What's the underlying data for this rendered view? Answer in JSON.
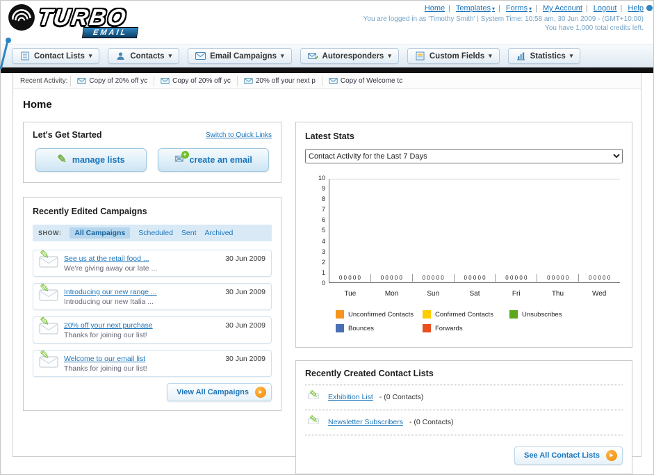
{
  "colors": {
    "link_blue": "#1B75BB",
    "accent_orange": "#F7941D",
    "bar_black": "#101010"
  },
  "header": {
    "logo_main": "TURBO",
    "logo_sub": "EMAIL",
    "nav": [
      {
        "label": "Home"
      },
      {
        "label": "Templates"
      },
      {
        "label": "Forms"
      },
      {
        "label": "My Account"
      },
      {
        "label": "Logout"
      },
      {
        "label": "Help"
      }
    ],
    "login_line": "You are logged in as 'Timothy Smith' | System Time: 10:58 am, 30 Jun 2009 - (GMT+10:00)",
    "credits_line": "You have 1,000 total credits left."
  },
  "main_nav": {
    "items": [
      "Contact Lists",
      "Contacts",
      "Email Campaigns",
      "Autoresponders",
      "Custom Fields",
      "Statistics"
    ]
  },
  "recent_activity": {
    "label": "Recent Activity:",
    "items": [
      "Copy of 20% off yc",
      "Copy of 20% off yc",
      "20% off your next p",
      "Copy of Welcome tc"
    ]
  },
  "page": {
    "title": "Home"
  },
  "getting_started": {
    "title": "Let's Get Started",
    "switch_link": "Switch to Quick Links",
    "manage_lists_label": "manage lists",
    "create_email_label": "create an email"
  },
  "campaigns": {
    "title": "Recently Edited Campaigns",
    "show_label": "SHOW:",
    "filters": [
      "All Campaigns",
      "Scheduled",
      "Sent",
      "Archived"
    ],
    "rows": [
      {
        "title": "See us at the retail food ...",
        "subtitle": "We're giving away our late ...",
        "date": "30 Jun 2009"
      },
      {
        "title": "Introducing our new range ...",
        "subtitle": "Introducing our new Italia ...",
        "date": "30 Jun 2009"
      },
      {
        "title": "20% off your next purchase",
        "subtitle": "Thanks for joining our list!",
        "date": "30 Jun 2009"
      },
      {
        "title": "Welcome to our email list",
        "subtitle": "Thanks for joining our list!",
        "date": "30 Jun 2009"
      }
    ],
    "view_all_label": "View All Campaigns"
  },
  "stats": {
    "title": "Latest Stats",
    "period_option": "Contact Activity for the Last 7 Days",
    "legend": [
      {
        "label": "Unconfirmed Contacts",
        "color": "#F7941D"
      },
      {
        "label": "Confirmed Contacts",
        "color": "#FFCC00"
      },
      {
        "label": "Unsubscribes",
        "color": "#5CA81D"
      },
      {
        "label": "Bounces",
        "color": "#4A6FB5"
      },
      {
        "label": "Forwards",
        "color": "#E8501F"
      }
    ]
  },
  "chart_data": {
    "type": "bar",
    "title": "Contact Activity for the Last 7 Days",
    "categories": [
      "Tue",
      "Mon",
      "Sun",
      "Sat",
      "Fri",
      "Thu",
      "Wed"
    ],
    "series": [
      {
        "name": "Unconfirmed Contacts",
        "values": [
          0,
          0,
          0,
          0,
          0,
          0,
          0
        ]
      },
      {
        "name": "Confirmed Contacts",
        "values": [
          0,
          0,
          0,
          0,
          0,
          0,
          0
        ]
      },
      {
        "name": "Unsubscribes",
        "values": [
          0,
          0,
          0,
          0,
          0,
          0,
          0
        ]
      },
      {
        "name": "Bounces",
        "values": [
          0,
          0,
          0,
          0,
          0,
          0,
          0
        ]
      },
      {
        "name": "Forwards",
        "values": [
          0,
          0,
          0,
          0,
          0,
          0,
          0
        ]
      }
    ],
    "ylim": [
      0,
      10
    ],
    "yticks": [
      0,
      1,
      2,
      3,
      4,
      5,
      6,
      7,
      8,
      9,
      10
    ],
    "legend_position": "bottom",
    "grid": false
  },
  "contact_lists": {
    "title": "Recently Created Contact Lists",
    "rows": [
      {
        "name": "Exhibition List",
        "suffix": "- (0 Contacts)"
      },
      {
        "name": "Newsletter Subscribers",
        "suffix": "- (0 Contacts)"
      }
    ],
    "see_all_label": "See All Contact Lists"
  }
}
